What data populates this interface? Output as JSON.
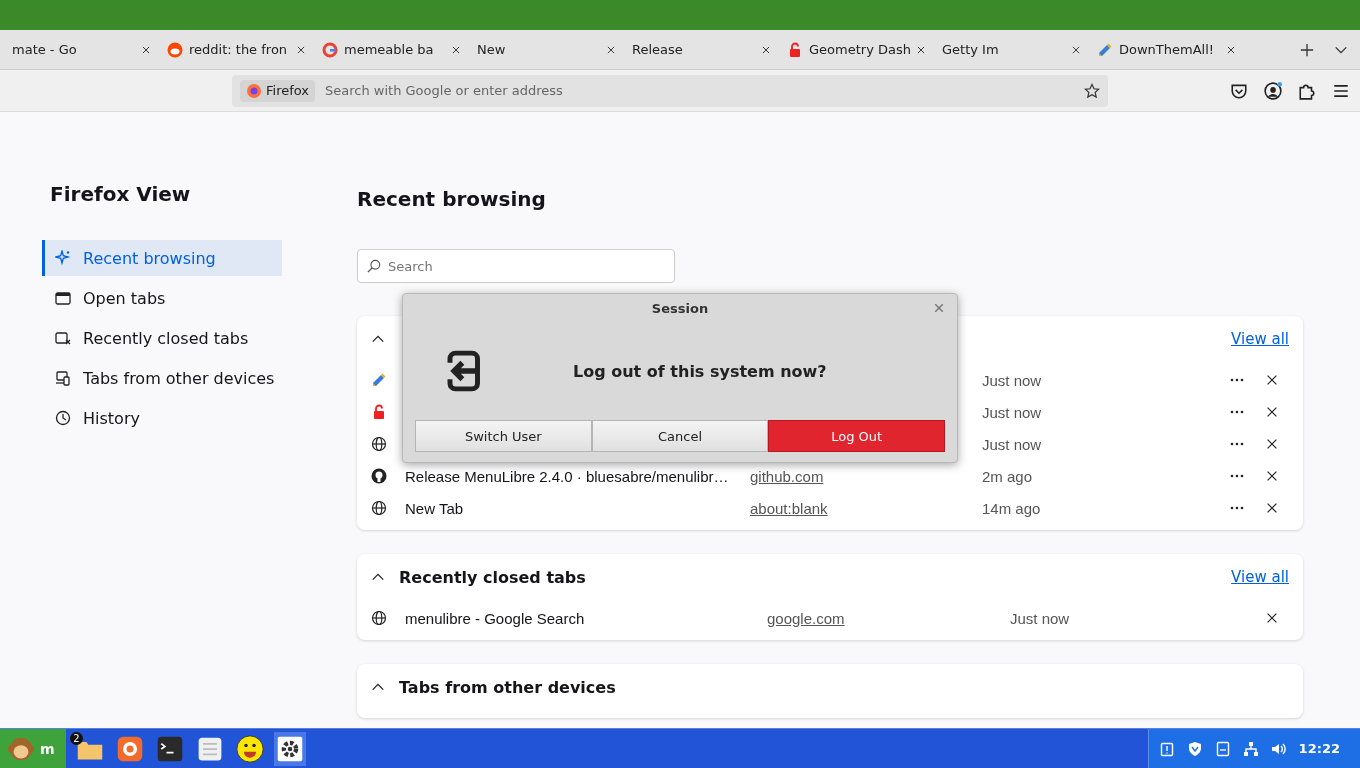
{
  "tabs": [
    {
      "title": "mate - Go",
      "selected": false
    },
    {
      "title": "reddit: the fron",
      "selected": false
    },
    {
      "title": "memeable ba",
      "selected": false
    },
    {
      "title": "New",
      "selected": false
    },
    {
      "title": "Release",
      "selected": false
    },
    {
      "title": "Geometry Dash",
      "selected": false
    },
    {
      "title": "Getty Im",
      "selected": false
    },
    {
      "title": "DownThemAll!",
      "selected": false
    }
  ],
  "address_bar": {
    "identity": "Firefox",
    "placeholder": "Search with Google or enter address"
  },
  "sidebar": {
    "title": "Firefox View",
    "items": [
      {
        "label": "Recent browsing",
        "selected": true
      },
      {
        "label": "Open tabs",
        "selected": false
      },
      {
        "label": "Recently closed tabs",
        "selected": false
      },
      {
        "label": "Tabs from other devices",
        "selected": false
      },
      {
        "label": "History",
        "selected": false
      }
    ]
  },
  "main": {
    "title": "Recent browsing",
    "search": {
      "placeholder": "Search"
    },
    "sections": [
      {
        "kind": "open",
        "view_all": "View all",
        "expanded": true,
        "rows": [
          {
            "time": "Just now"
          },
          {
            "time": "Just now"
          },
          {
            "time": "Just now"
          },
          {
            "title": "Release MenuLibre 2.4.0 · bluesabre/menulibr…",
            "url": "github.com",
            "time": "2m ago"
          },
          {
            "title": "New Tab",
            "url": "about:blank",
            "time": "14m ago"
          }
        ]
      },
      {
        "kind": "closed",
        "title": "Recently closed tabs",
        "view_all": "View all",
        "expanded": true,
        "rows": [
          {
            "title": "menulibre - Google Search",
            "url": "google.com",
            "time": "Just now"
          }
        ]
      },
      {
        "kind": "devices",
        "title": "Tabs from other devices",
        "expanded": true
      }
    ]
  },
  "dialog": {
    "title": "Session",
    "message": "Log out of this system now?",
    "buttons": [
      {
        "label": "Switch User",
        "kind": "normal"
      },
      {
        "label": "Cancel",
        "kind": "normal"
      },
      {
        "label": "Log Out",
        "kind": "danger"
      }
    ]
  },
  "taskbar": {
    "start_label": "m",
    "apps": [
      {
        "kind": "folder",
        "badge": "2"
      },
      {
        "kind": "firefox"
      },
      {
        "kind": "terminal"
      },
      {
        "kind": "notes"
      },
      {
        "kind": "smiley"
      },
      {
        "kind": "settings"
      }
    ],
    "clock": "12:22"
  }
}
